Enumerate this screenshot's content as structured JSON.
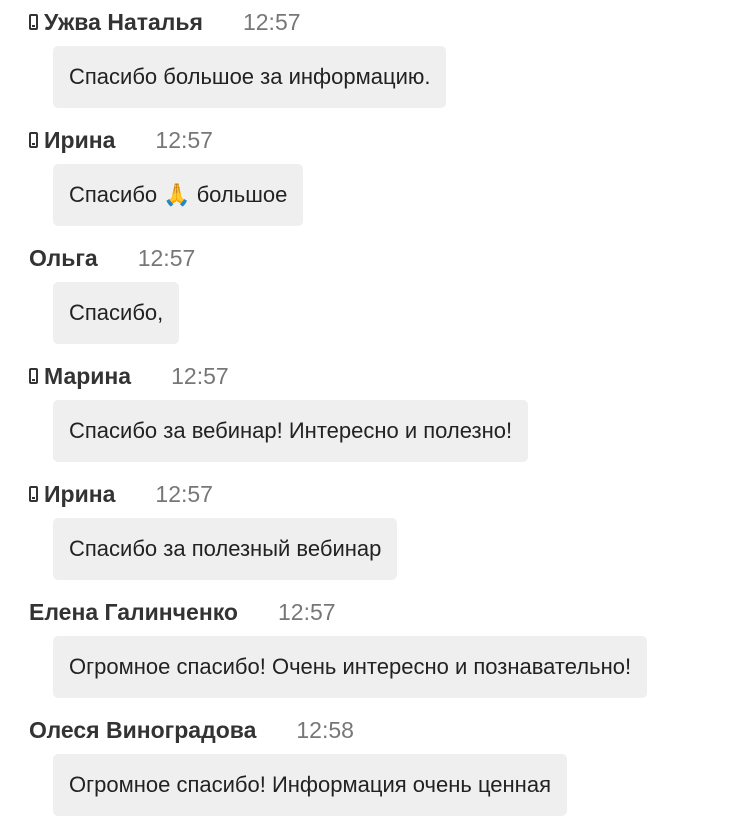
{
  "messages": [
    {
      "author": "Ужва Наталья",
      "time": "12:57",
      "mobile": true,
      "text": "Спасибо большое за информацию."
    },
    {
      "author": "Ирина",
      "time": "12:57",
      "mobile": true,
      "text_before": "Спасибо",
      "emoji": "🙏",
      "text_after": "большое"
    },
    {
      "author": "Ольга",
      "time": "12:57",
      "mobile": false,
      "text": "Спасибо,"
    },
    {
      "author": "Марина",
      "time": "12:57",
      "mobile": true,
      "text": "Спасибо за вебинар! Интересно и полезно!"
    },
    {
      "author": "Ирина",
      "time": "12:57",
      "mobile": true,
      "text": "Спасибо за полезный вебинар"
    },
    {
      "author": "Елена Галинченко",
      "time": "12:57",
      "mobile": false,
      "text": "Огромное спасибо! Очень интересно и познавательно!"
    },
    {
      "author": "Олеся Виноградова",
      "time": "12:58",
      "mobile": false,
      "text": "Огромное спасибо! Информация очень ценная"
    }
  ],
  "colors": {
    "bubble_background": "#efefef",
    "author_text": "#333333",
    "time_text": "#777777"
  }
}
